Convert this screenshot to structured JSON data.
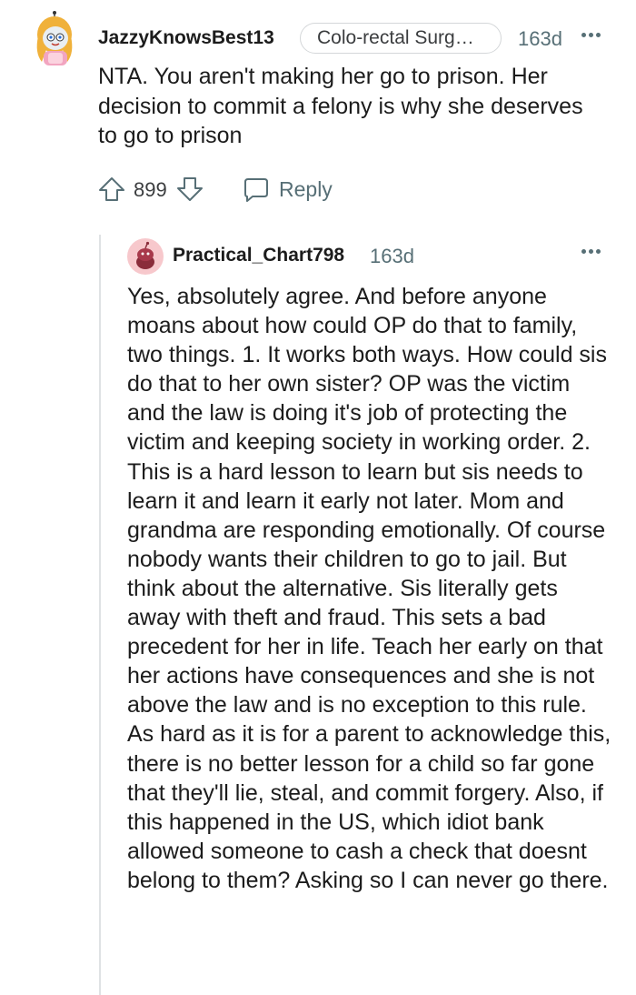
{
  "comment": {
    "author": "JazzyKnowsBest13",
    "flair": "Colo-rectal Surg…",
    "age": "163d",
    "body": "NTA. You aren't making her go to prison. Her decision to commit a felony is why she deserves to go to prison",
    "score": "899",
    "reply_label": "Reply"
  },
  "reply": {
    "author": "Practical_Chart798",
    "age": "163d",
    "body": "Yes, absolutely agree. And before anyone moans about how could OP do that to family, two things. 1. It works both ways. How could sis do that to her own sister? OP was the victim and the law is doing it's job of protecting the victim and keeping society in working order. 2. This is a hard lesson to learn but sis needs to learn it and learn it early not later. Mom and grandma are responding emotionally. Of course nobody wants their children to go to jail. But think about the alternative. Sis literally gets away with theft and fraud. This sets a bad precedent for her in life. Teach her early on that her actions have consequences and she is not above the law and is no exception to this rule. As hard as it is for a parent to acknowledge this, there is no better lesson for a child so far gone that they'll lie, steal, and commit forgery. Also, if this happened in the US, which idiot bank allowed someone to cash a check that doesnt belong to them? Asking so I can never go there."
  },
  "icons": {
    "upvote": "upvote-arrow-icon",
    "downvote": "downvote-arrow-icon",
    "reply": "speech-bubble-icon",
    "more": "overflow-menu-icon"
  },
  "colors": {
    "text": "#1c1c1c",
    "meta": "#576f76",
    "thread_line": "#dfe2e4",
    "reply_avatar_bg": "#f7c8cc"
  }
}
